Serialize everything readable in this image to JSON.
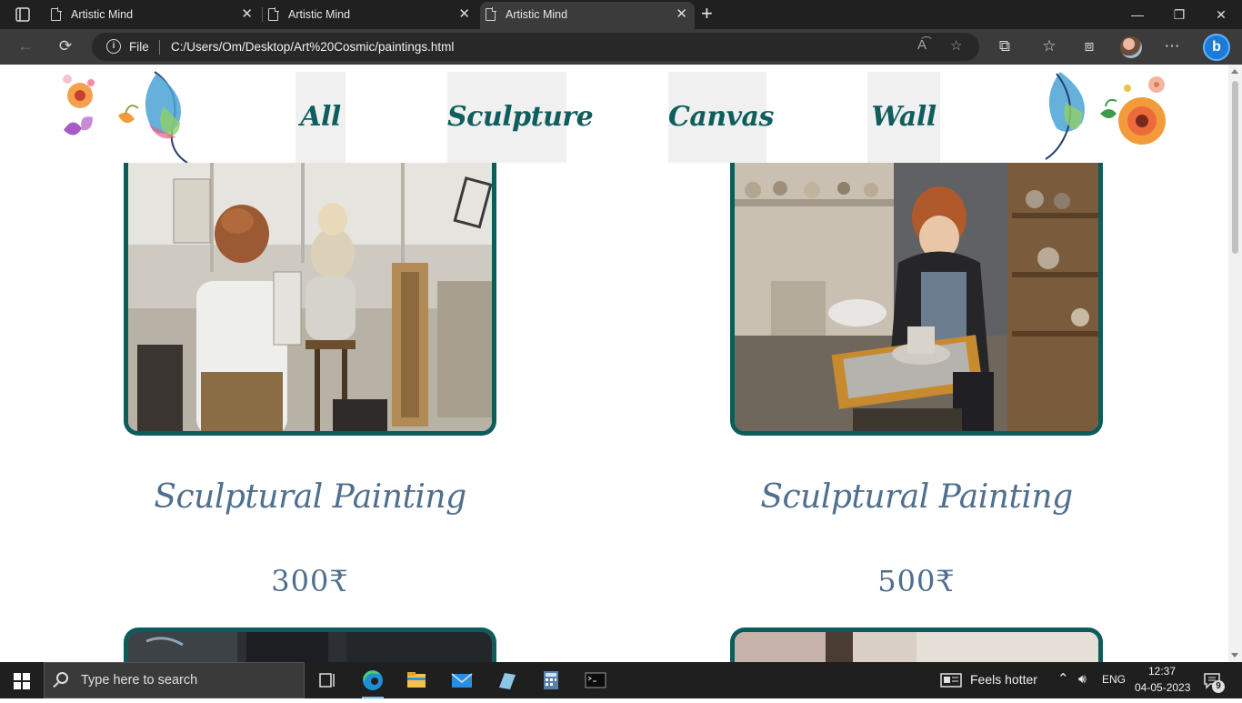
{
  "browser": {
    "tabs": [
      {
        "title": "Artistic Mind",
        "close": "✕"
      },
      {
        "title": "Artistic Mind",
        "close": "✕"
      },
      {
        "title": "Artistic Mind",
        "close": "✕"
      }
    ],
    "new_tab": "+",
    "window_controls": {
      "minimize": "—",
      "restore": "❐",
      "close": "✕"
    },
    "address": {
      "scheme_label": "File",
      "url": "C:/Users/Om/Desktop/Art%20Cosmic/paintings.html"
    }
  },
  "page": {
    "nav": [
      {
        "label": "All"
      },
      {
        "label": "Sculpture"
      },
      {
        "label": "Canvas"
      },
      {
        "label": "Wall"
      }
    ],
    "products": [
      {
        "title": "Sculptural Painting",
        "price": "300₹"
      },
      {
        "title": "Sculptural Painting",
        "price": "500₹"
      }
    ],
    "accent_color": "#0d5c5c",
    "text_color": "#4f6f8f"
  },
  "taskbar": {
    "search_placeholder": "Type here to search",
    "weather": "Feels hotter",
    "language": "ENG",
    "time": "12:37",
    "date": "04-05-2023",
    "notification_count": "9"
  }
}
